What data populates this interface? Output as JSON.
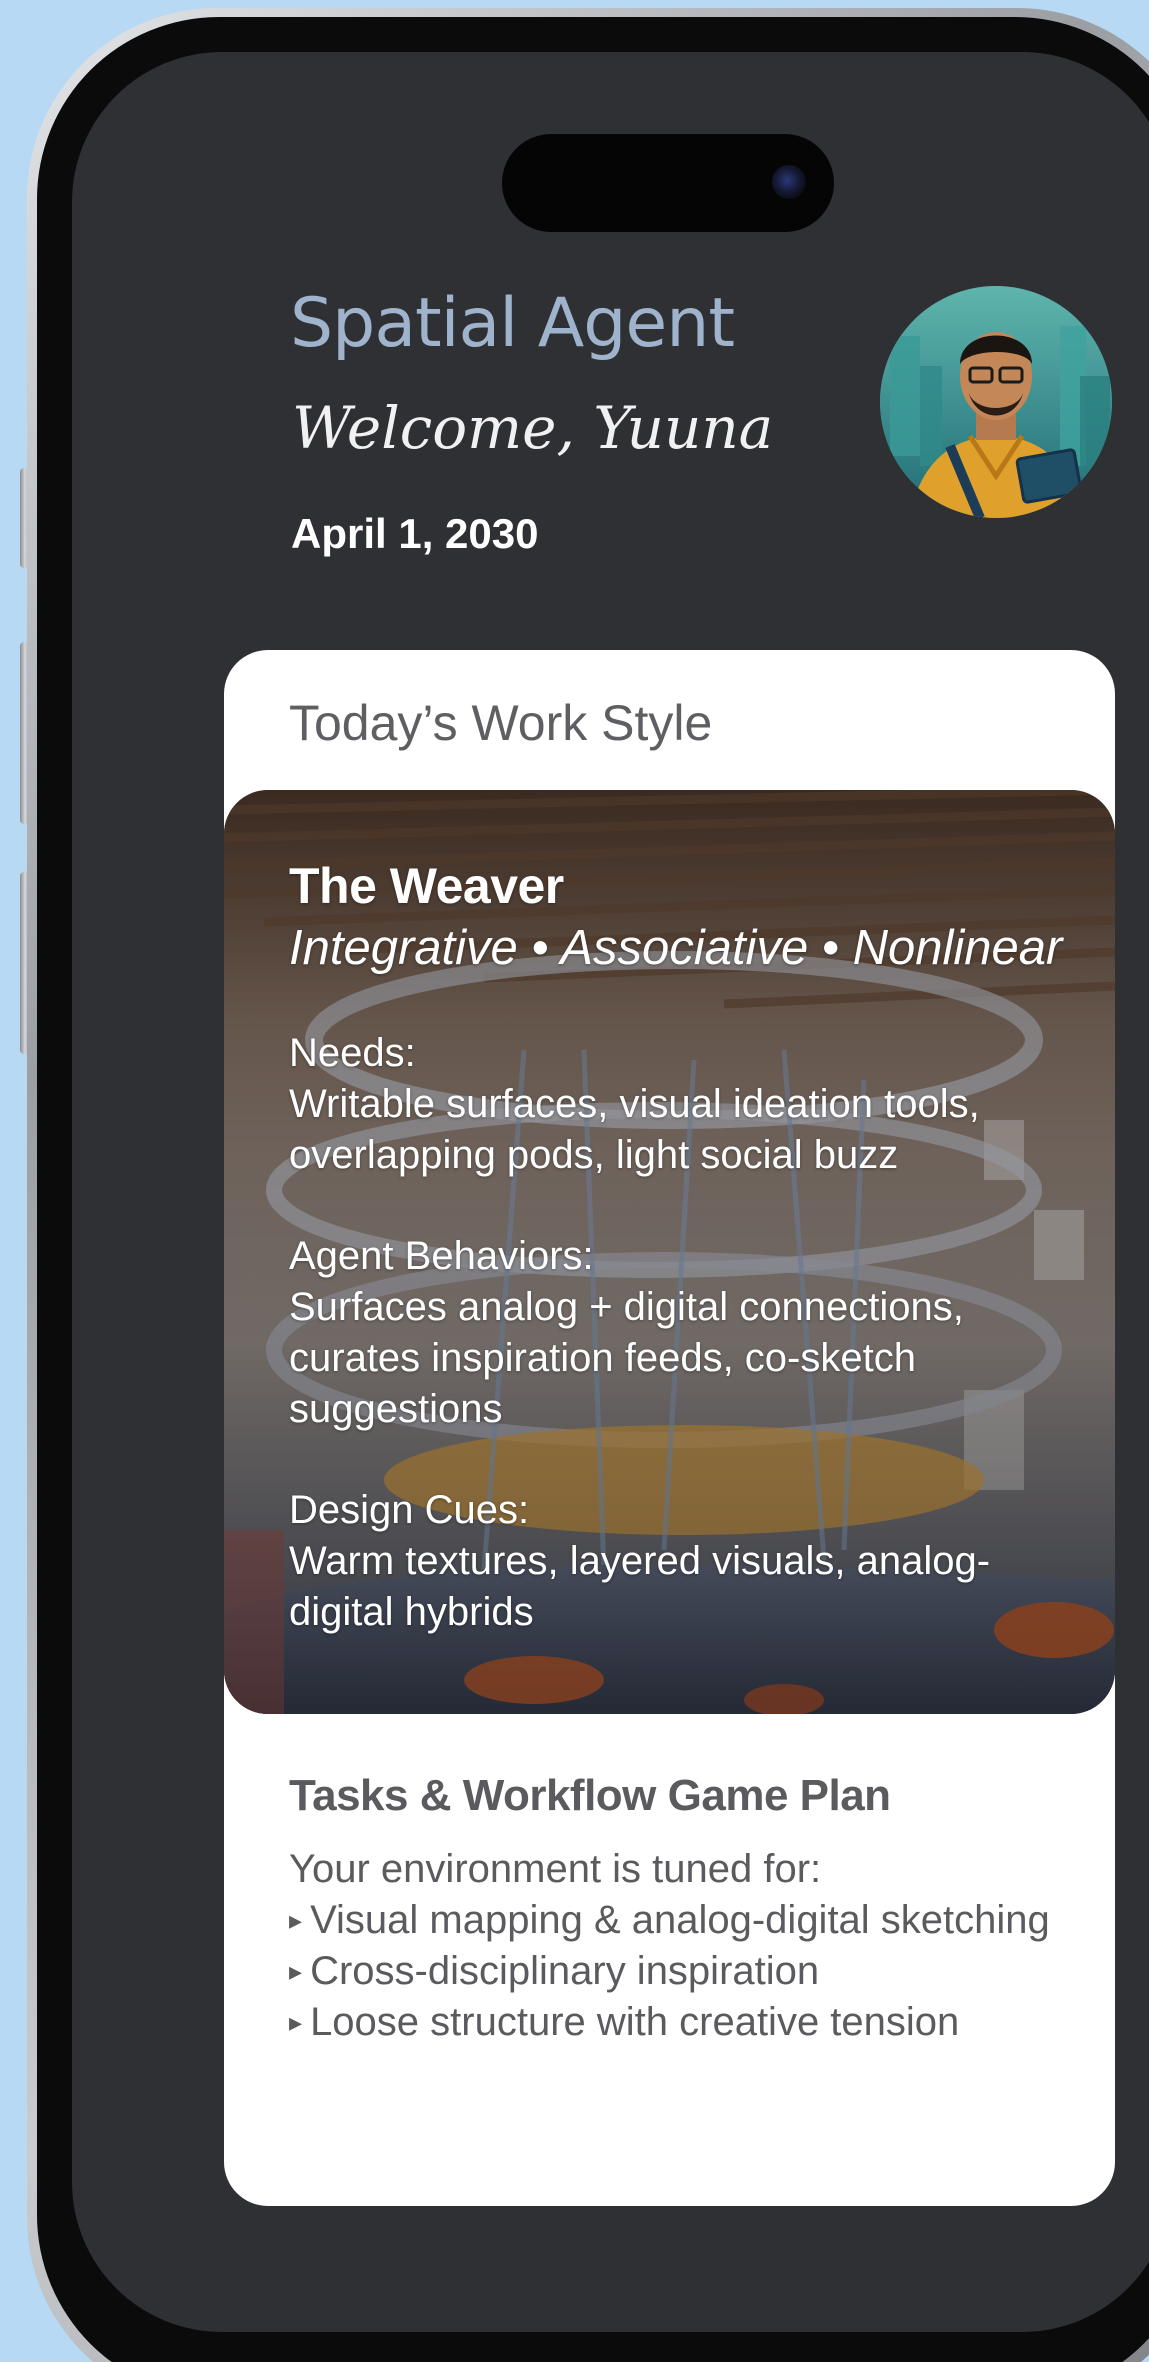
{
  "header": {
    "app_title": "Spatial Agent",
    "welcome": "Welcome, Yuuna",
    "date": "April 1, 2030"
  },
  "work_style": {
    "card_title": "Today’s Work Style",
    "persona_name": "The Weaver",
    "traits": "Integrative • Associative • Nonlinear",
    "needs_label": "Needs:",
    "needs_text": "Writable surfaces, visual ideation tools, overlapping pods, light social buzz",
    "agent_label": "Agent Behaviors:",
    "agent_text": "Surfaces analog + digital connections, curates inspiration feeds, co-sketch suggestions",
    "design_label": "Design Cues:",
    "design_text": "Warm textures, layered visuals, analog-digital hybrids"
  },
  "plan": {
    "title": "Tasks & Workflow Game Plan",
    "intro": "Your environment is tuned for:",
    "bullet_glyph": "▸",
    "items": [
      "Visual mapping & analog-digital sketching",
      "Cross-disciplinary inspiration",
      "Loose structure with creative tension"
    ]
  },
  "colors": {
    "background": "#b8d9f3",
    "screen": "#2f3033",
    "app_title": "#9fb3cc",
    "card": "#ffffff",
    "card_text": "#5b5b5f"
  },
  "icons": {
    "avatar": "user-avatar-illustration"
  }
}
